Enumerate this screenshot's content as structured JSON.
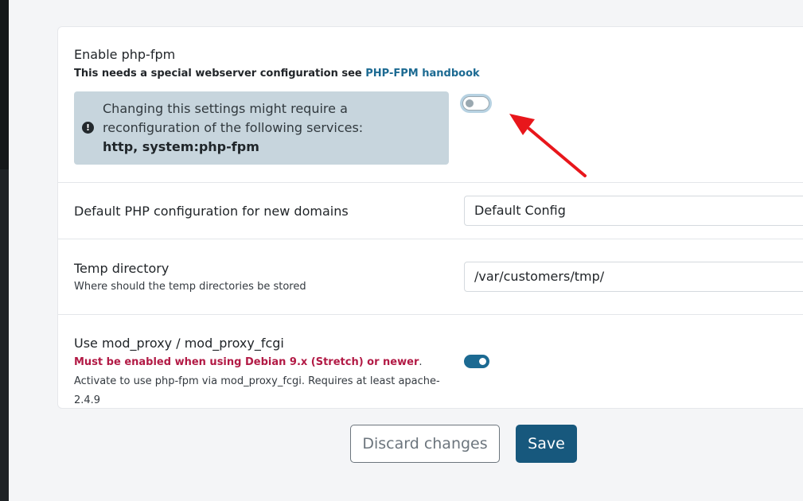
{
  "settings": {
    "php_fpm": {
      "label": "Enable php-fpm",
      "help_prefix": "This needs a special webserver configuration see ",
      "help_link": "PHP-FPM handbook",
      "alert_line": "Changing this settings might require a reconfiguration of the following services:",
      "alert_services": "http, system:php-fpm",
      "enabled": false
    },
    "default_php_config": {
      "label": "Default PHP configuration for new domains",
      "value": "Default Config"
    },
    "temp_directory": {
      "label": "Temp directory",
      "help": "Where should the temp directories be stored",
      "value": "/var/customers/tmp/"
    },
    "mod_proxy": {
      "label": "Use mod_proxy / mod_proxy_fcgi",
      "help_warning": "Must be enabled when using Debian 9.x (Stretch) or newer",
      "help_rest": ". Activate to use php-fpm via mod_proxy_fcgi. Requires at least apache-2.4.9",
      "enabled": true
    }
  },
  "actions": {
    "discard_label": "Discard changes",
    "save_label": "Save"
  },
  "icons": {
    "alert": "exclamation-circle-icon",
    "annotation": "red-arrow-icon"
  },
  "colors": {
    "accent": "#1c6a92",
    "danger": "#b21a45",
    "alert_bg": "#c7d5dd",
    "arrow": "#e8161b"
  }
}
